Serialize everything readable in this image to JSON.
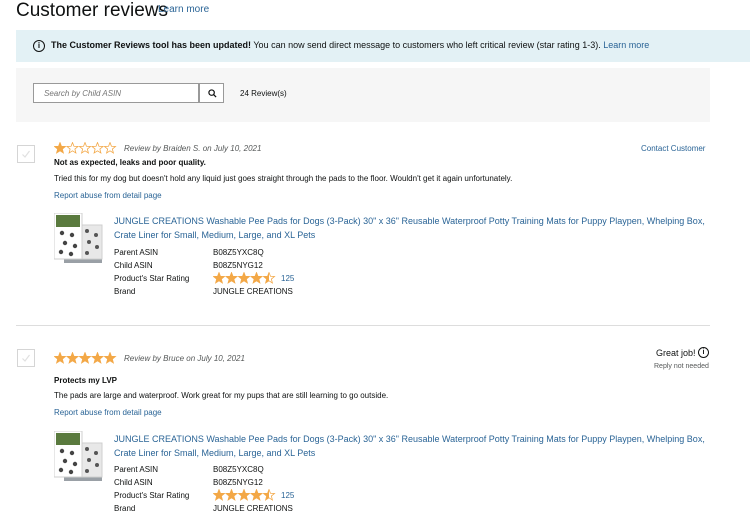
{
  "header": {
    "title": "Customer reviews",
    "learn_more": "Learn more"
  },
  "banner": {
    "bold_text": "The Customer Reviews tool has been updated!",
    "text": " You can now send direct message to customers who left critical review (star rating 1-3).",
    "link": "Learn more"
  },
  "search": {
    "placeholder": "Search by Child ASIN",
    "review_count": "24 Review(s)"
  },
  "reviews": [
    {
      "rating": 1,
      "meta": "Review by Braiden S. on July 10, 2021",
      "title": "Not as expected, leaks and poor quality.",
      "body": "Tried this for my dog but doesn't hold any liquid just goes straight through the pads to the floor. Wouldn't get it again unfortunately.",
      "report": "Report abuse from detail page",
      "action": "Contact Customer",
      "product": {
        "title": "JUNGLE CREATIONS Washable Pee Pads for Dogs (3-Pack) 30\" x 36\" Reusable Waterproof Potty Training Mats for Puppy Playpen, Whelping Box, Crate Liner for Small, Medium, Large, and XL Pets",
        "labels": {
          "parent_asin": "Parent ASIN",
          "child_asin": "Child ASIN",
          "star_rating": "Product's Star Rating",
          "brand": "Brand"
        },
        "parent_asin": "B08Z5YXC8Q",
        "child_asin": "B08Z5NYG12",
        "star_rating": 4.5,
        "rating_count": "125",
        "brand": "JUNGLE CREATIONS"
      }
    },
    {
      "rating": 5,
      "meta": "Review by Bruce on July 10, 2021",
      "title": "Protects my LVP",
      "body": "The pads are large and waterproof. Work great for my pups that are still learning to go outside.",
      "report": "Report abuse from detail page",
      "action": "Great job!",
      "action_info": "i",
      "reply_status": "Reply not needed",
      "product": {
        "title": "JUNGLE CREATIONS Washable Pee Pads for Dogs (3-Pack) 30\" x 36\" Reusable Waterproof Potty Training Mats for Puppy Playpen, Whelping Box, Crate Liner for Small, Medium, Large, and XL Pets",
        "labels": {
          "parent_asin": "Parent ASIN",
          "child_asin": "Child ASIN",
          "star_rating": "Product's Star Rating",
          "brand": "Brand"
        },
        "parent_asin": "B08Z5YXC8Q",
        "child_asin": "B08Z5NYG12",
        "star_rating": 4.5,
        "rating_count": "125",
        "brand": "JUNGLE CREATIONS"
      }
    }
  ],
  "icons": {
    "banner": "info-icon",
    "search": "search-icon",
    "checkbox": "check-icon"
  },
  "colors": {
    "link": "#2a6496",
    "star": "#f3a847",
    "banner_bg": "#e3f1f5"
  }
}
